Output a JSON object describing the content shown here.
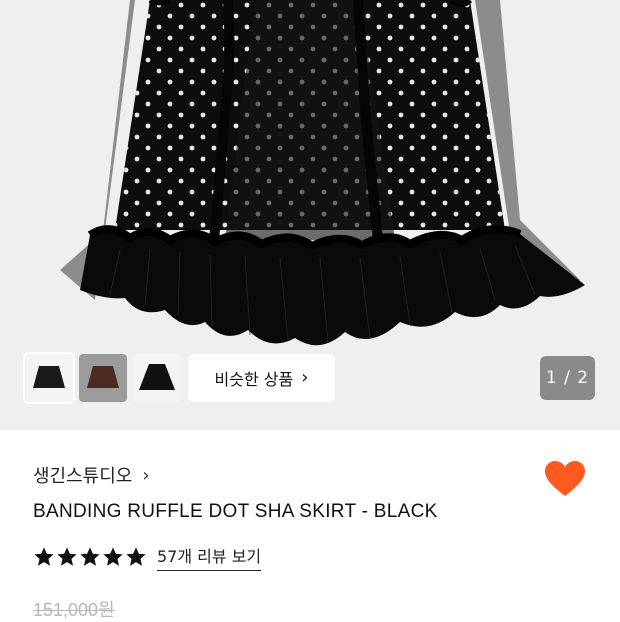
{
  "gallery": {
    "similar_label": "비슷한 상품",
    "similar_chevron": "›",
    "pager": "1 / 2",
    "thumbnails": [
      {
        "name": "black skirt",
        "color": "#1a1a1a"
      },
      {
        "name": "brown skirt",
        "color": "#4a2a22"
      },
      {
        "name": "black skirt alt",
        "color": "#111111"
      }
    ]
  },
  "product": {
    "brand": "생긴스튜디오",
    "brand_chevron": "›",
    "title": "BANDING RUFFLE DOT SHA SKIRT - BLACK",
    "rating": 5,
    "review_link": "57개 리뷰 보기",
    "original_price": "151,000원",
    "liked": true
  },
  "colors": {
    "accent_heart": "#ff5a1f",
    "hero_bg": "#efefef"
  }
}
